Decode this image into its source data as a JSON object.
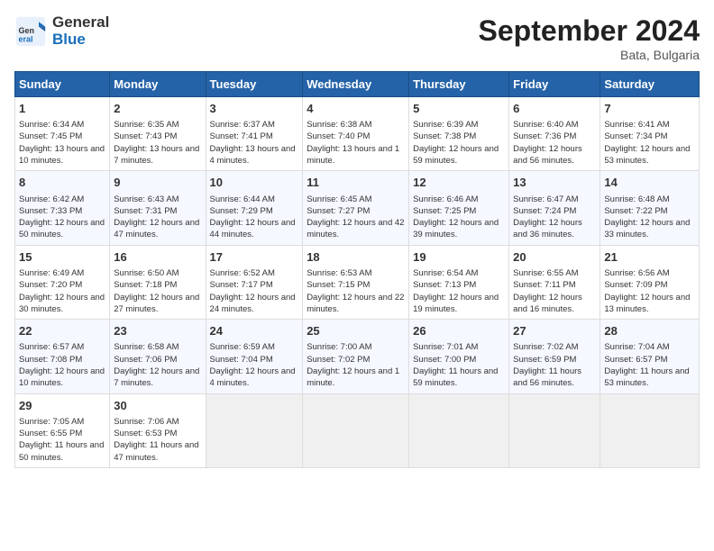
{
  "logo": {
    "general": "General",
    "blue": "Blue"
  },
  "title": "September 2024",
  "location": "Bata, Bulgaria",
  "columns": [
    "Sunday",
    "Monday",
    "Tuesday",
    "Wednesday",
    "Thursday",
    "Friday",
    "Saturday"
  ],
  "weeks": [
    [
      {
        "day": "1",
        "sunrise": "6:34 AM",
        "sunset": "7:45 PM",
        "daylight": "13 hours and 10 minutes."
      },
      {
        "day": "2",
        "sunrise": "6:35 AM",
        "sunset": "7:43 PM",
        "daylight": "13 hours and 7 minutes."
      },
      {
        "day": "3",
        "sunrise": "6:37 AM",
        "sunset": "7:41 PM",
        "daylight": "13 hours and 4 minutes."
      },
      {
        "day": "4",
        "sunrise": "6:38 AM",
        "sunset": "7:40 PM",
        "daylight": "13 hours and 1 minute."
      },
      {
        "day": "5",
        "sunrise": "6:39 AM",
        "sunset": "7:38 PM",
        "daylight": "12 hours and 59 minutes."
      },
      {
        "day": "6",
        "sunrise": "6:40 AM",
        "sunset": "7:36 PM",
        "daylight": "12 hours and 56 minutes."
      },
      {
        "day": "7",
        "sunrise": "6:41 AM",
        "sunset": "7:34 PM",
        "daylight": "12 hours and 53 minutes."
      }
    ],
    [
      {
        "day": "8",
        "sunrise": "6:42 AM",
        "sunset": "7:33 PM",
        "daylight": "12 hours and 50 minutes."
      },
      {
        "day": "9",
        "sunrise": "6:43 AM",
        "sunset": "7:31 PM",
        "daylight": "12 hours and 47 minutes."
      },
      {
        "day": "10",
        "sunrise": "6:44 AM",
        "sunset": "7:29 PM",
        "daylight": "12 hours and 44 minutes."
      },
      {
        "day": "11",
        "sunrise": "6:45 AM",
        "sunset": "7:27 PM",
        "daylight": "12 hours and 42 minutes."
      },
      {
        "day": "12",
        "sunrise": "6:46 AM",
        "sunset": "7:25 PM",
        "daylight": "12 hours and 39 minutes."
      },
      {
        "day": "13",
        "sunrise": "6:47 AM",
        "sunset": "7:24 PM",
        "daylight": "12 hours and 36 minutes."
      },
      {
        "day": "14",
        "sunrise": "6:48 AM",
        "sunset": "7:22 PM",
        "daylight": "12 hours and 33 minutes."
      }
    ],
    [
      {
        "day": "15",
        "sunrise": "6:49 AM",
        "sunset": "7:20 PM",
        "daylight": "12 hours and 30 minutes."
      },
      {
        "day": "16",
        "sunrise": "6:50 AM",
        "sunset": "7:18 PM",
        "daylight": "12 hours and 27 minutes."
      },
      {
        "day": "17",
        "sunrise": "6:52 AM",
        "sunset": "7:17 PM",
        "daylight": "12 hours and 24 minutes."
      },
      {
        "day": "18",
        "sunrise": "6:53 AM",
        "sunset": "7:15 PM",
        "daylight": "12 hours and 22 minutes."
      },
      {
        "day": "19",
        "sunrise": "6:54 AM",
        "sunset": "7:13 PM",
        "daylight": "12 hours and 19 minutes."
      },
      {
        "day": "20",
        "sunrise": "6:55 AM",
        "sunset": "7:11 PM",
        "daylight": "12 hours and 16 minutes."
      },
      {
        "day": "21",
        "sunrise": "6:56 AM",
        "sunset": "7:09 PM",
        "daylight": "12 hours and 13 minutes."
      }
    ],
    [
      {
        "day": "22",
        "sunrise": "6:57 AM",
        "sunset": "7:08 PM",
        "daylight": "12 hours and 10 minutes."
      },
      {
        "day": "23",
        "sunrise": "6:58 AM",
        "sunset": "7:06 PM",
        "daylight": "12 hours and 7 minutes."
      },
      {
        "day": "24",
        "sunrise": "6:59 AM",
        "sunset": "7:04 PM",
        "daylight": "12 hours and 4 minutes."
      },
      {
        "day": "25",
        "sunrise": "7:00 AM",
        "sunset": "7:02 PM",
        "daylight": "12 hours and 1 minute."
      },
      {
        "day": "26",
        "sunrise": "7:01 AM",
        "sunset": "7:00 PM",
        "daylight": "11 hours and 59 minutes."
      },
      {
        "day": "27",
        "sunrise": "7:02 AM",
        "sunset": "6:59 PM",
        "daylight": "11 hours and 56 minutes."
      },
      {
        "day": "28",
        "sunrise": "7:04 AM",
        "sunset": "6:57 PM",
        "daylight": "11 hours and 53 minutes."
      }
    ],
    [
      {
        "day": "29",
        "sunrise": "7:05 AM",
        "sunset": "6:55 PM",
        "daylight": "11 hours and 50 minutes."
      },
      {
        "day": "30",
        "sunrise": "7:06 AM",
        "sunset": "6:53 PM",
        "daylight": "11 hours and 47 minutes."
      },
      null,
      null,
      null,
      null,
      null
    ]
  ]
}
